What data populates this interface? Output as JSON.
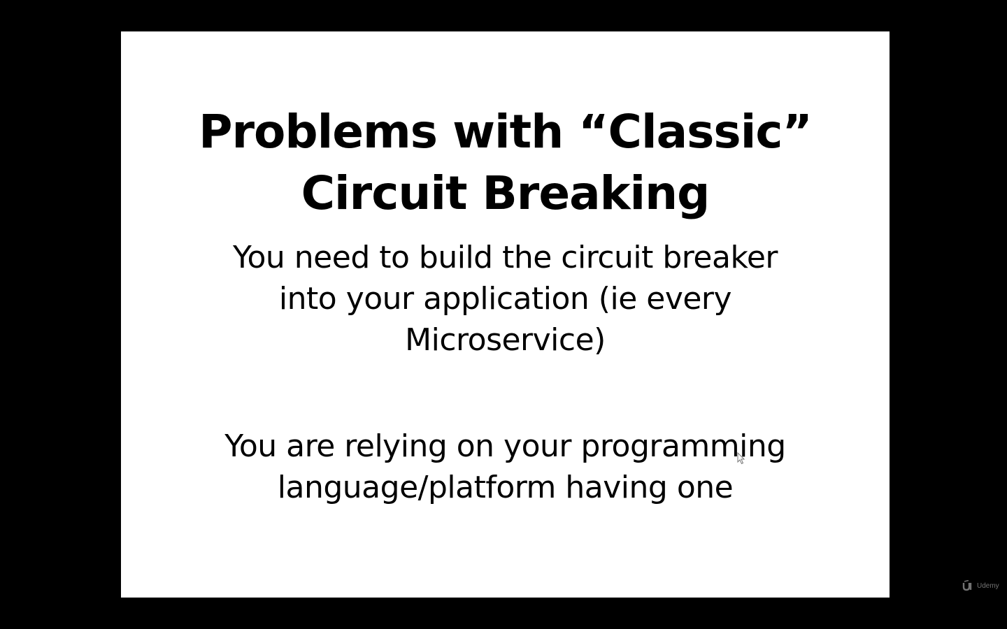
{
  "slide": {
    "title_lines": [
      "Problems with “Classic”",
      "Circuit Breaking"
    ],
    "paragraph_1_lines": [
      "You need to build the circuit breaker",
      "into your application (ie every",
      "Microservice)"
    ],
    "paragraph_2_lines": [
      "You are relying on your programming",
      "language/platform having one"
    ]
  },
  "watermark": {
    "label": "Udemy",
    "icon": "udemy-logo-icon"
  },
  "cursor": {
    "icon": "mouse-pointer-icon"
  },
  "colors": {
    "background": "#000000",
    "slide": "#ffffff",
    "text": "#000000"
  }
}
